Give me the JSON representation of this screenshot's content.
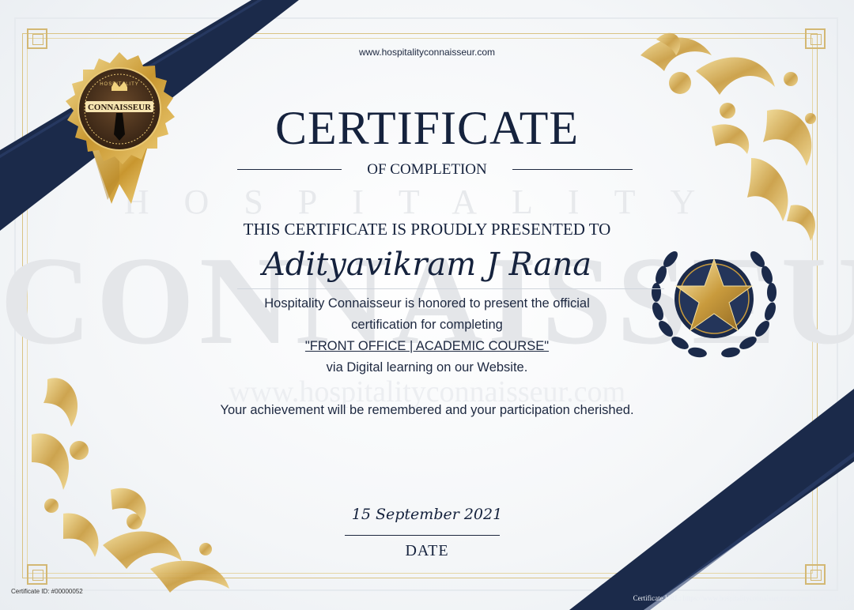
{
  "website": "www.hospitalityconnaisseur.com",
  "title": "CERTIFICATE",
  "subtitle": "OF COMPLETION",
  "presented_to": "THIS CERTIFICATE IS PROUDLY PRESENTED TO",
  "recipient_name": "Adityavikram J Rana",
  "body_lines": [
    "Hospitality Connaisseur is honored to present the official",
    "certification for completing",
    "\"FRONT OFFICE | ACADEMIC COURSE\"",
    "via Digital learning on our Website.",
    "Your achievement will be remembered and your participation cherished."
  ],
  "date_value": "15 September 2021",
  "date_label": "DATE",
  "certificate_id": "Certificate ID: #00000052",
  "certificate_url": "Certificate URL: https://www.hospitalityconnaisseur.com/certificate/4d1d127",
  "watermark": {
    "top": "HOSPITALITY",
    "middle": "CONNAISSEUR",
    "bottom": "www.hospitalityconnaisseur.com"
  },
  "seal": {
    "top_text": "HOSPITALITY",
    "main_text": "CONNAISSEUR",
    "icon": "crown-tie-icon"
  },
  "badge_icon": "star-laurel-icon",
  "colors": {
    "navy": "#1b2a4a",
    "gold": "#c99b3d",
    "text": "#15223d"
  }
}
